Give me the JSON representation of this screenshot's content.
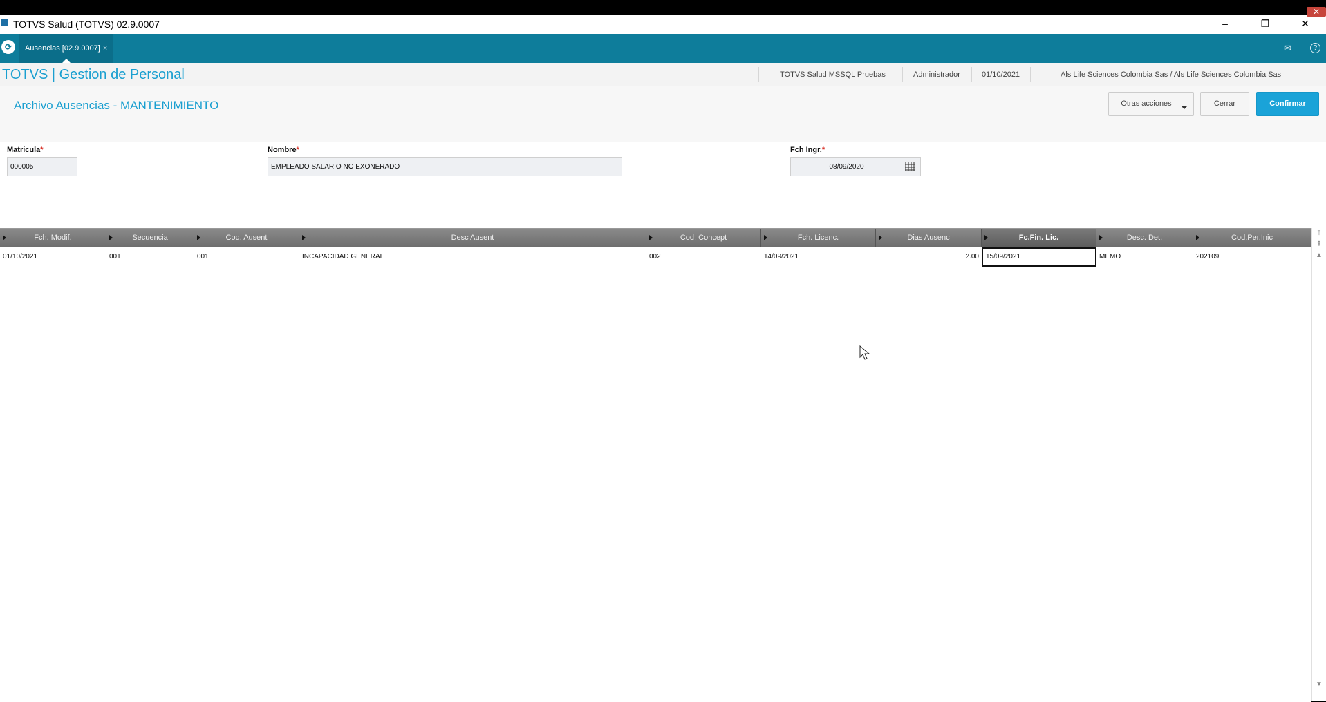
{
  "window": {
    "title": "TOTVS Salud (TOTVS) 02.9.0007",
    "minimize": "–",
    "restore": "❐",
    "close": "✕"
  },
  "tabbar": {
    "tab_label": "Ausencias [02.9.0007]",
    "tab_close": "×",
    "mail_icon": "✉",
    "help_icon": "?"
  },
  "header": {
    "brand": "TOTVS | Gestion de Personal",
    "environment": "TOTVS Salud MSSQL Pruebas",
    "user": "Administrador",
    "date": "01/10/2021",
    "company": "Als Life Sciences Colombia Sas / Als Life Sciences Colombia Sas"
  },
  "page": {
    "title": "Archivo Ausencias - MANTENIMIENTO",
    "other_actions": "Otras acciones",
    "close": "Cerrar",
    "confirm": "Confirmar"
  },
  "form": {
    "matricula_label": "Matricula",
    "matricula_value": "000005",
    "nombre_label": "Nombre",
    "nombre_value": "EMPLEADO SALARIO NO EXONERADO",
    "fch_ingr_label": "Fch Ingr.",
    "fch_ingr_value": "08/09/2020",
    "required_mark": "*"
  },
  "grid": {
    "headers": [
      "Fch. Modif.",
      "Secuencia",
      "Cod. Ausent",
      "Desc Ausent",
      "Cod. Concept",
      "Fch. Licenc.",
      "Dias Ausenc",
      "Fc.Fin. Lic.",
      "Desc. Det.",
      "Cod.Per.Inic"
    ],
    "rows": [
      [
        "01/10/2021",
        "001",
        "001",
        "INCAPACIDAD GENERAL",
        "002",
        "14/09/2021",
        "2.00",
        "15/09/2021",
        "MEMO",
        "202109"
      ]
    ]
  }
}
